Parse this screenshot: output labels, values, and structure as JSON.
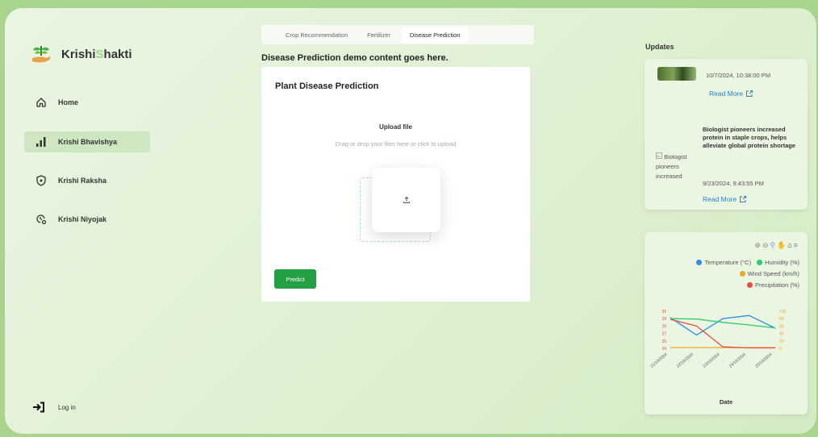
{
  "brand": {
    "prefix": "Krishi",
    "highlight": "S",
    "suffix": "hakti"
  },
  "nav": {
    "home": "Home",
    "bhavishya": "Krishi Bhavishya",
    "raksha": "Krishi Raksha",
    "niyojak": "Krishi Niyojak",
    "login": "Log in"
  },
  "tabs": [
    "Crop Recommendation",
    "Fertilizer",
    "Disease Prediction"
  ],
  "main": {
    "demo_text": "Disease Prediction demo content goes here.",
    "card_title": "Plant Disease Prediction",
    "upload_title": "Upload file",
    "upload_hint": "Drag or drop your files here or click to upload",
    "predict_label": "Predict"
  },
  "updates": {
    "heading": "Updates",
    "item1": {
      "date": "10/7/2024, 10:38:00 PM",
      "read_more": "Read More"
    },
    "item2": {
      "image_alt": "Biologist pioneers increased",
      "title": "Biologist pioneers increased protein in staple crops, helps alleviate global protein shortage",
      "date": "9/23/2024, 9:43:55 PM",
      "read_more": "Read More"
    }
  },
  "colors": {
    "accent": "#22a043",
    "link": "#2a7fd4"
  },
  "chart_data": {
    "type": "line",
    "xlabel": "Date",
    "x": [
      "21/10/2024",
      "22/10/2024",
      "23/10/2024",
      "24/10/2024",
      "25/10/2024"
    ],
    "ylim_left": [
      24,
      31
    ],
    "ylim_right": [
      0,
      100
    ],
    "left_ticks": [
      "31",
      "29",
      "26",
      "27",
      "25",
      "24"
    ],
    "right_ticks": [
      "100",
      "80",
      "60",
      "40",
      "20",
      "0"
    ],
    "series": [
      {
        "name": "Temperature (°C)",
        "color": "#2e8fe8",
        "axis": "left",
        "values": [
          29.8,
          26.5,
          29.6,
          30.2,
          27.8
        ]
      },
      {
        "name": "Humidity (%)",
        "color": "#2ecc71",
        "axis": "right",
        "values": [
          80,
          79,
          70,
          63,
          55
        ]
      },
      {
        "name": "Wind Speed (km/h)",
        "color": "#f5a623",
        "axis": "right",
        "values": [
          2,
          2,
          2,
          2,
          2
        ]
      },
      {
        "name": "Precipitation (%)",
        "color": "#e74c3c",
        "axis": "right",
        "values": [
          78,
          60,
          4,
          1,
          1
        ]
      }
    ]
  }
}
